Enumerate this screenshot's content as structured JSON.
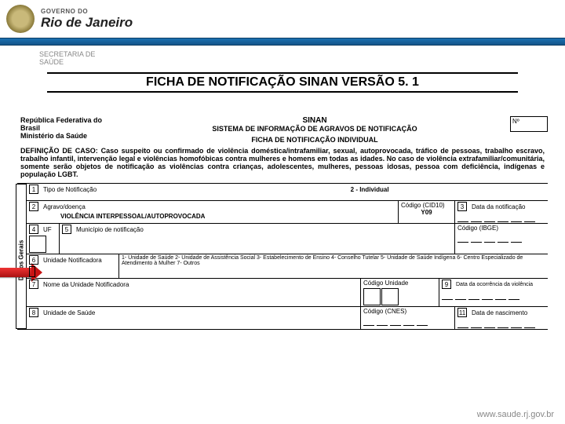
{
  "header": {
    "gov_line": "GOVERNO DO",
    "state": "Rio de Janeiro",
    "sub_org_l1": "SECRETARIA DE",
    "sub_org_l2": "SAÚDE"
  },
  "page_title": "FICHA DE NOTIFICAÇÃO SINAN VERSÃO 5. 1",
  "form": {
    "country": "República Federativa do Brasil",
    "ministry": "Ministério da Saúde",
    "system_short": "SINAN",
    "system_full": "SISTEMA DE INFORMAÇÃO DE AGRAVOS DE NOTIFICAÇÃO",
    "form_name": "FICHA DE NOTIFICAÇÃO  INDIVIDUAL",
    "number_label": "Nº",
    "definition": "DEFINIÇÃO DE CASO: Caso suspeito ou confirmado de violência doméstica/intrafamiliar, sexual, autoprovocada, tráfico de pessoas, trabalho escravo, trabalho infantil, intervenção legal e violências homofóbicas contra mulheres e homens em todas as idades. No caso de violência extrafamiliar/comunitária, somente serão objetos de notificação as violências contra crianças, adolescentes, mulheres, pessoas idosas, pessoa com deficiência, indígenas e população LGBT.",
    "side_tab": "Dados Gerais",
    "fields": {
      "f1": {
        "num": "1",
        "label": "Tipo de Notificação",
        "value": "2 - Individual"
      },
      "f2": {
        "num": "2",
        "label": "Agravo/doença",
        "value": "VIOLÊNCIA INTERPESSOAL/AUTOPROVOCADA",
        "code_label": "Código (CID10)",
        "code_value": "Y09"
      },
      "f3": {
        "num": "3",
        "label": "Data da notificação"
      },
      "f4": {
        "num": "4",
        "label": "UF"
      },
      "f5": {
        "num": "5",
        "label": "Município de notificação",
        "code_label": "Código (IBGE)"
      },
      "f6": {
        "num": "6",
        "label": "Unidade Notificadora",
        "options": "1- Unidade de Saúde   2- Unidade de Assistência Social   3- Estabelecimento de Ensino   4- Conselho Tutelar  5- Unidade de Saúde Indígena  6- Centro Especializado de Atendimento à Mulher   7- Outros"
      },
      "f7": {
        "num": "7",
        "label": "Nome da Unidade Notificadora",
        "code_label": "Código Unidade"
      },
      "f8": {
        "num": "8",
        "label": "Unidade de Saúde",
        "code_label": "Código (CNES)"
      },
      "f9": {
        "num": "9",
        "label": "Data da ocorrência da violência"
      },
      "f11": {
        "num": "11",
        "label": "Data de nascimento"
      }
    }
  },
  "footer_url": "www.saude.rj.gov.br"
}
